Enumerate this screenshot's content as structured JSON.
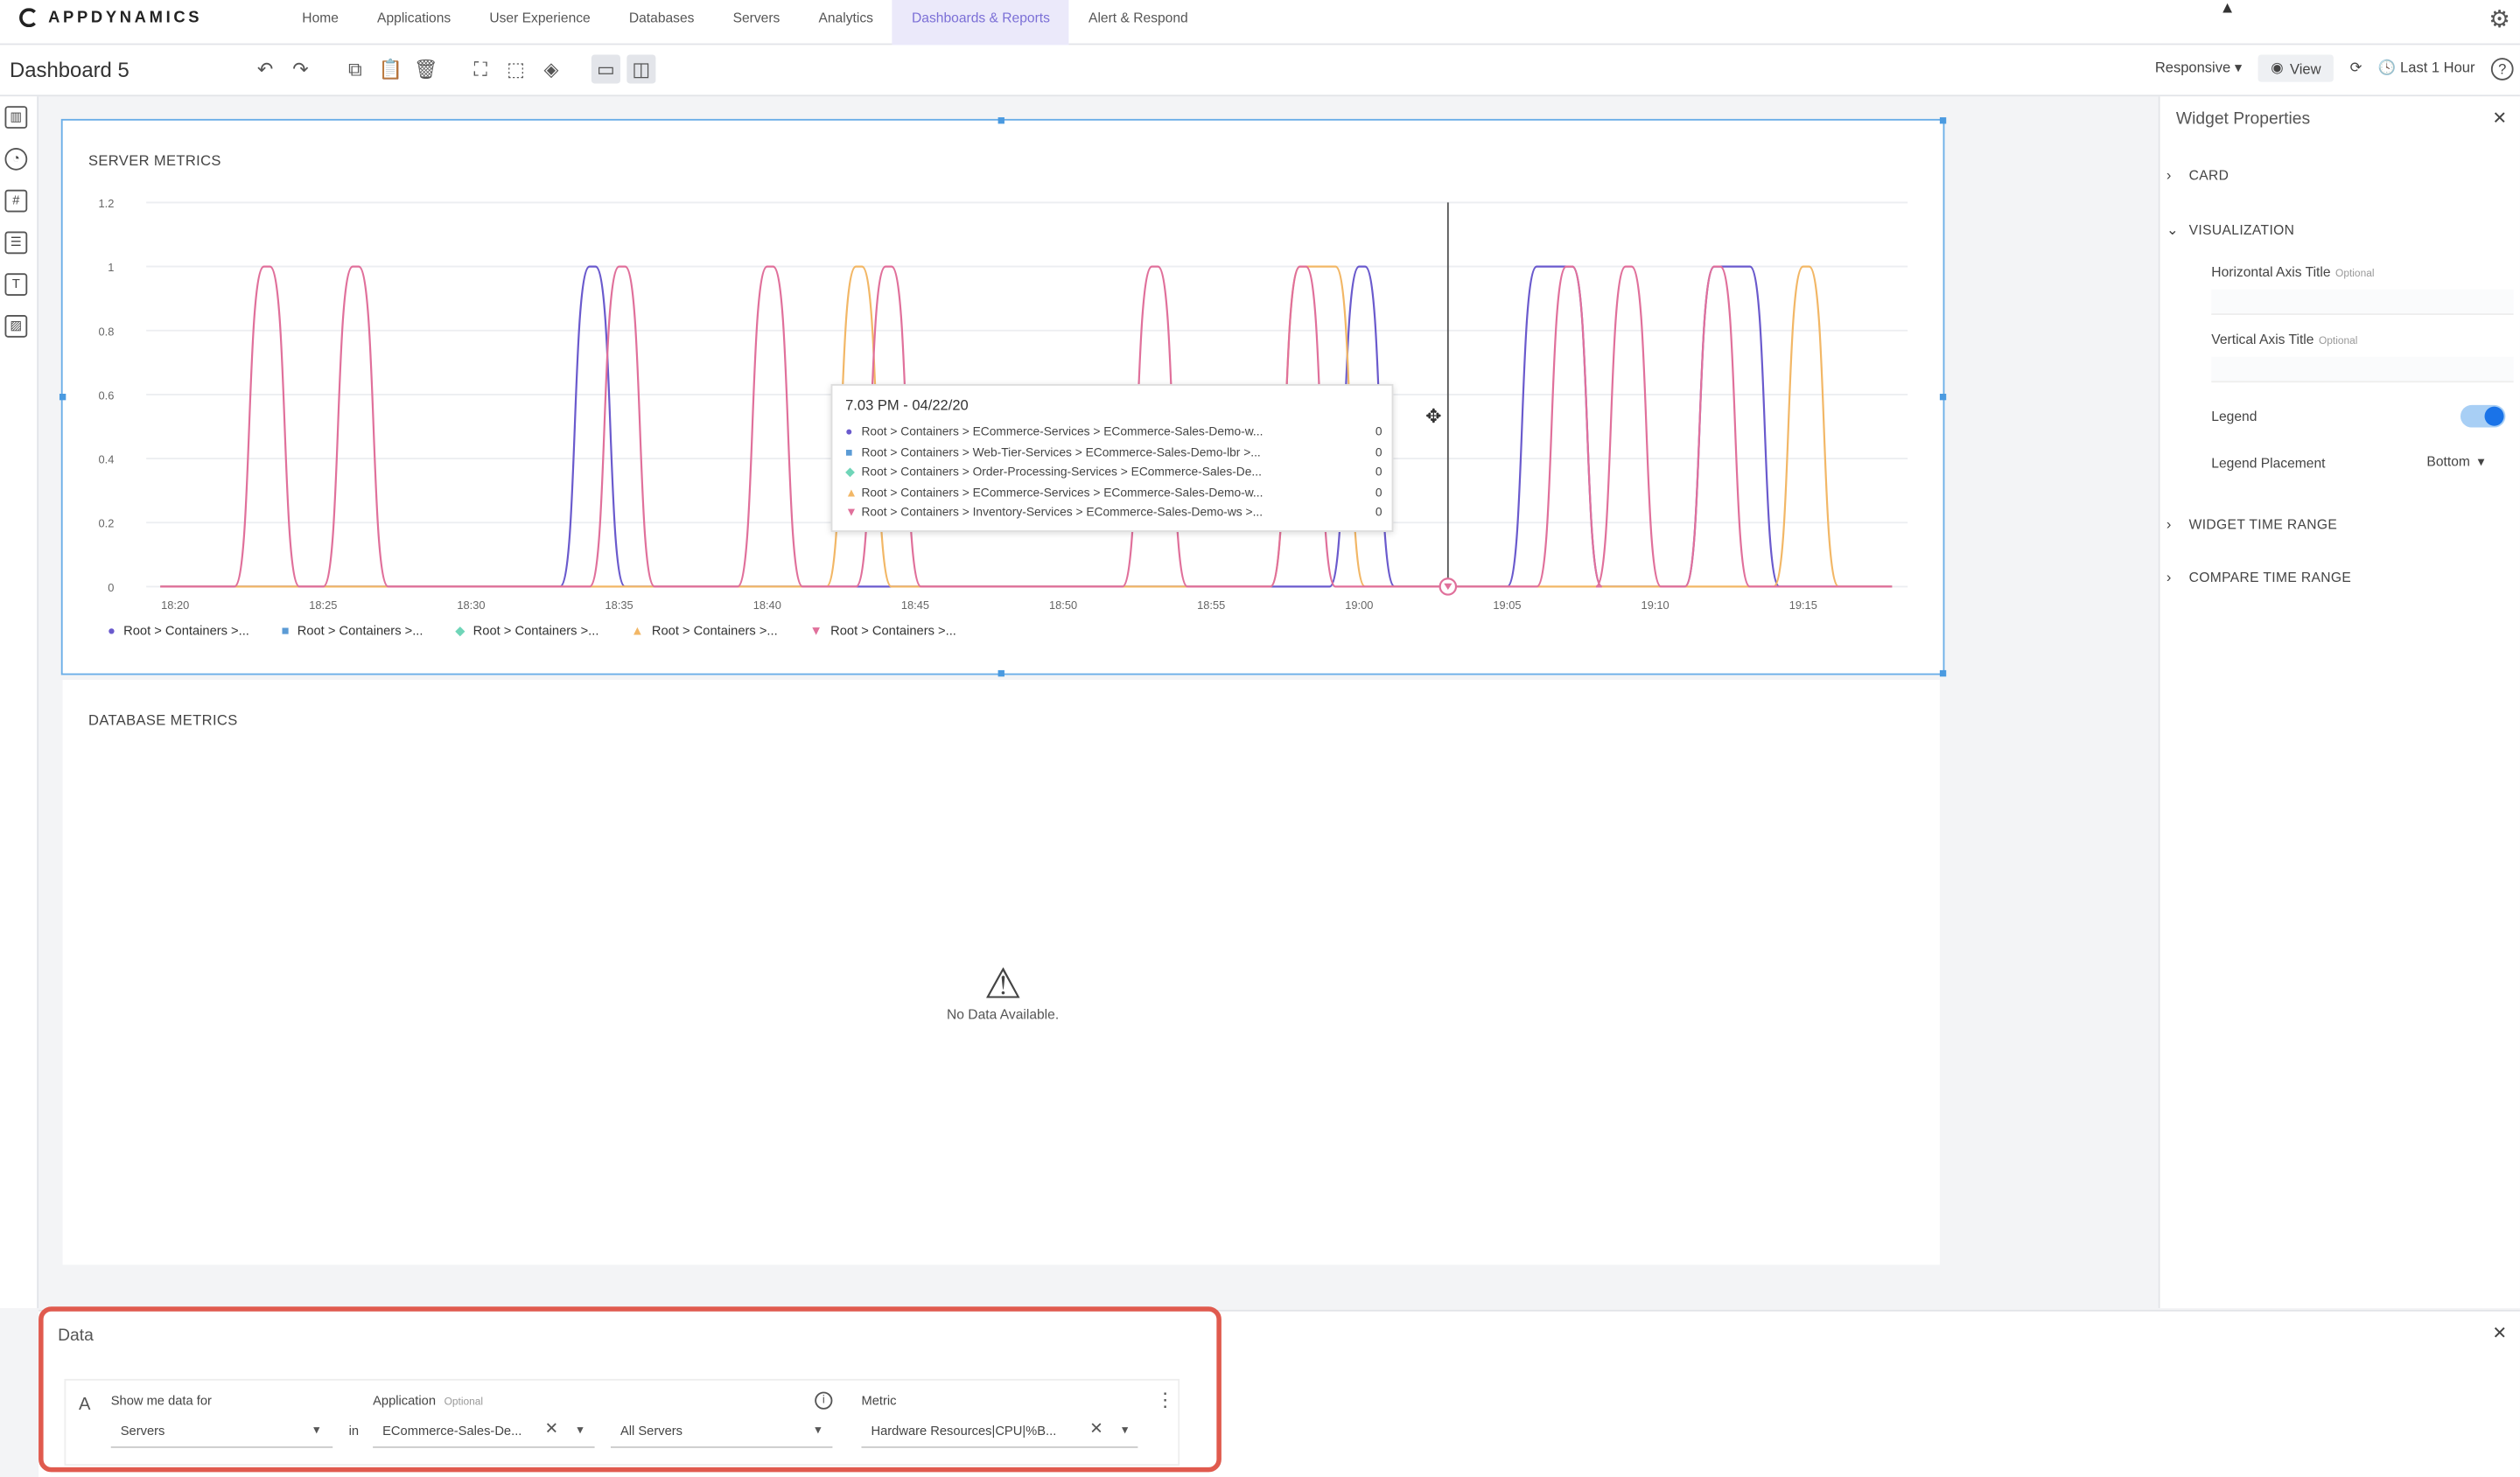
{
  "nav": {
    "brand": "APPDYNAMICS",
    "items": [
      "Home",
      "Applications",
      "User Experience",
      "Databases",
      "Servers",
      "Analytics",
      "Dashboards & Reports",
      "Alert & Respond"
    ],
    "active_index": 6
  },
  "toolbar": {
    "title": "Dashboard 5",
    "layout_mode": "Responsive",
    "view_label": "View",
    "time_range": "Last 1 Hour"
  },
  "widgets": {
    "server": {
      "title": "SERVER METRICS",
      "tooltip": {
        "title": "7.03 PM - 04/22/20",
        "rows": [
          {
            "text": "Root > Containers > ECommerce-Services > ECommerce-Sales-Demo-w...",
            "value": "0"
          },
          {
            "text": "Root > Containers > Web-Tier-Services > ECommerce-Sales-Demo-lbr >...",
            "value": "0"
          },
          {
            "text": "Root > Containers > Order-Processing-Services > ECommerce-Sales-De...",
            "value": "0"
          },
          {
            "text": "Root > Containers > ECommerce-Services > ECommerce-Sales-Demo-w...",
            "value": "0"
          },
          {
            "text": "Root > Containers > Inventory-Services > ECommerce-Sales-Demo-ws >...",
            "value": "0"
          }
        ]
      }
    },
    "database": {
      "title": "DATABASE METRICS",
      "no_data": "No Data Available."
    }
  },
  "chart_data": {
    "type": "line",
    "ylim": [
      0,
      1.2
    ],
    "yticks": [
      "1.2",
      "1",
      "0.8",
      "0.6",
      "0.4",
      "0.2",
      "0"
    ],
    "xticks": [
      "18:20",
      "18:25",
      "18:30",
      "18:35",
      "18:40",
      "18:45",
      "18:50",
      "18:55",
      "19:00",
      "19:05",
      "19:10",
      "19:15"
    ],
    "series": [
      {
        "name": "Root > Containers >...",
        "color": "#6a5acd",
        "marker": "circle",
        "pulses": [
          {
            "start": "18:34",
            "end": "18:34"
          },
          {
            "start": "19:00",
            "end": "19:00"
          },
          {
            "start": "19:06",
            "end": "19:07"
          },
          {
            "start": "19:12",
            "end": "19:13"
          }
        ]
      },
      {
        "name": "Root > Containers >...",
        "color": "#5b9bd5",
        "marker": "square",
        "pulses": []
      },
      {
        "name": "Root > Containers >...",
        "color": "#6fd5b8",
        "marker": "diamond",
        "pulses": []
      },
      {
        "name": "Root > Containers >...",
        "color": "#f2b766",
        "marker": "triangle",
        "pulses": [
          {
            "start": "18:43",
            "end": "18:43"
          },
          {
            "start": "18:58",
            "end": "18:59"
          },
          {
            "start": "19:15",
            "end": "19:15"
          }
        ]
      },
      {
        "name": "Root > Containers >...",
        "color": "#e0709b",
        "marker": "triangle-down",
        "pulses": [
          {
            "start": "18:23",
            "end": "18:23"
          },
          {
            "start": "18:26",
            "end": "18:26"
          },
          {
            "start": "18:35",
            "end": "18:35"
          },
          {
            "start": "18:40",
            "end": "18:40"
          },
          {
            "start": "18:44",
            "end": "18:44"
          },
          {
            "start": "18:53",
            "end": "18:53"
          },
          {
            "start": "18:58",
            "end": "18:58"
          },
          {
            "start": "19:07",
            "end": "19:07"
          },
          {
            "start": "19:09",
            "end": "19:09"
          },
          {
            "start": "19:12",
            "end": "19:12"
          }
        ]
      }
    ],
    "crosshair_time": "19:03"
  },
  "props": {
    "title": "Widget Properties",
    "sections": {
      "card": "CARD",
      "visualization": "VISUALIZATION",
      "widget_time": "WIDGET TIME RANGE",
      "compare_time": "COMPARE TIME RANGE"
    },
    "h_axis": "Horizontal Axis Title",
    "v_axis": "Vertical Axis Title",
    "optional": "Optional",
    "legend": "Legend",
    "legend_enabled": true,
    "legend_placement_label": "Legend Placement",
    "legend_placement": "Bottom"
  },
  "data_panel": {
    "title": "Data",
    "query_letter": "A",
    "show_label": "Show me data for",
    "show_value": "Servers",
    "in_label": "in",
    "app_label": "Application",
    "app_optional": "Optional",
    "app_value": "ECommerce-Sales-De...",
    "servers_value": "All Servers",
    "metric_label": "Metric",
    "metric_value": "Hardware Resources|CPU|%B..."
  },
  "colors": {
    "accent": "#7b6fd6",
    "selection": "#4a9ae0",
    "highlight": "#e05a4e",
    "toggle": "#1a73e8"
  }
}
